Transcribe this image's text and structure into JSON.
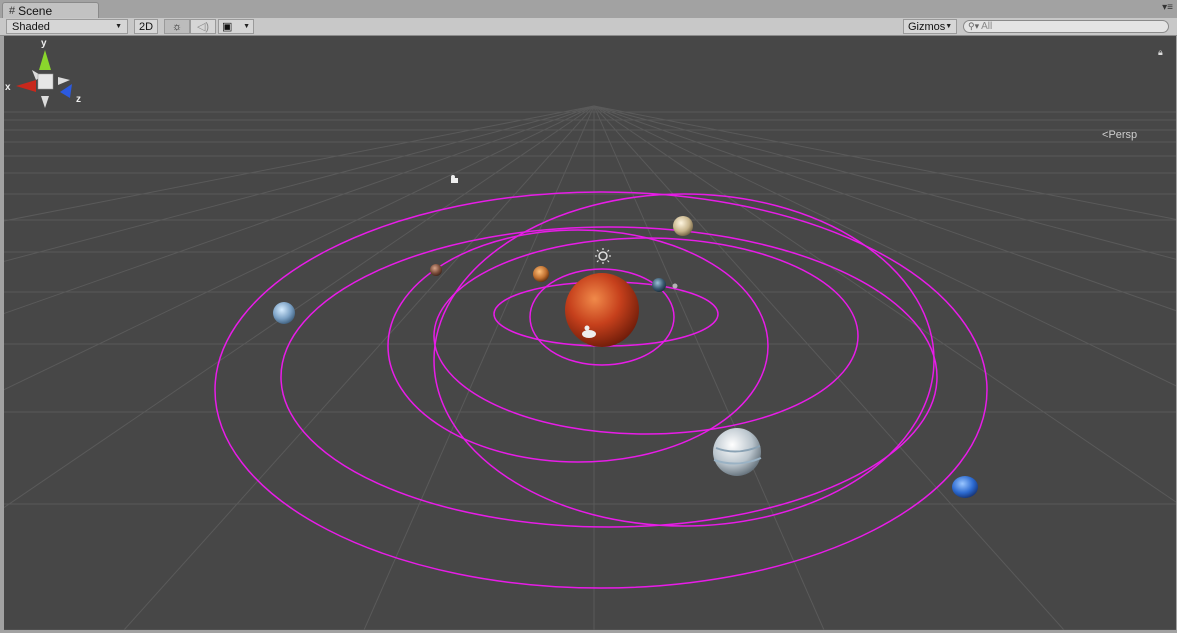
{
  "tab": {
    "icon": "grid-icon",
    "label": "Scene"
  },
  "toolbar": {
    "draw_mode": "Shaded",
    "mode_2d": "2D",
    "lighting_icon": "sun-icon",
    "audio_icon": "speaker-icon",
    "effects_icon": "image-icon",
    "gizmos_label": "Gizmos",
    "search_placeholder": "All"
  },
  "gizmo": {
    "x": "x",
    "y": "y",
    "z": "z",
    "projection": "Persp"
  },
  "colors": {
    "orbit": "#e81ce8",
    "background": "#474747",
    "x_axis": "#c8281c",
    "y_axis": "#8ad62c",
    "z_axis": "#2c5ae0"
  }
}
